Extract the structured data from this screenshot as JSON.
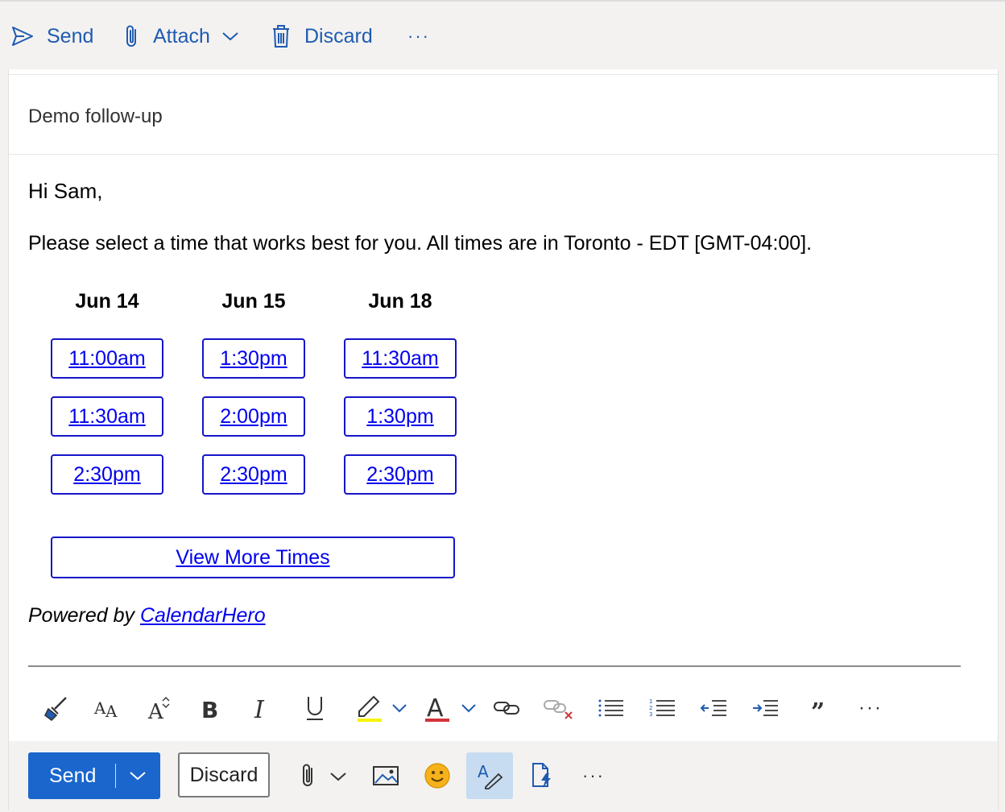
{
  "toolbar": {
    "send_label": "Send",
    "attach_label": "Attach",
    "discard_label": "Discard",
    "more_label": "···"
  },
  "compose": {
    "subject": "Demo follow-up"
  },
  "email": {
    "greeting": "Hi Sam,",
    "intro": "Please select a time that works best for you. All times are in Toronto - EDT [GMT-04:00].",
    "days": [
      {
        "label": "Jun 14",
        "slots": [
          "11:00am",
          "11:30am",
          "2:30pm"
        ]
      },
      {
        "label": "Jun 15",
        "slots": [
          "1:30pm",
          "2:00pm",
          "2:30pm"
        ]
      },
      {
        "label": "Jun 18",
        "slots": [
          "11:30am",
          "1:30pm",
          "2:30pm"
        ]
      }
    ],
    "view_more": "View More Times",
    "powered_prefix": "Powered by ",
    "powered_link": "CalendarHero"
  },
  "format_toolbar": {
    "more_label": "···",
    "icons": [
      "format-painter-icon",
      "font-size-icon",
      "grow-font-icon",
      "bold-icon",
      "italic-icon",
      "underline-icon",
      "highlight-icon",
      "font-color-icon",
      "link-icon",
      "unlink-icon",
      "bullets-icon",
      "numbering-icon",
      "decrease-indent-icon",
      "increase-indent-icon",
      "quote-icon"
    ]
  },
  "actions": {
    "send_label": "Send",
    "discard_label": "Discard",
    "more_label": "···"
  },
  "colors": {
    "accent": "#1a66cc",
    "toolbar_text": "#1f5bb0",
    "link": "#0000ee",
    "slot_border": "#1515c8"
  }
}
